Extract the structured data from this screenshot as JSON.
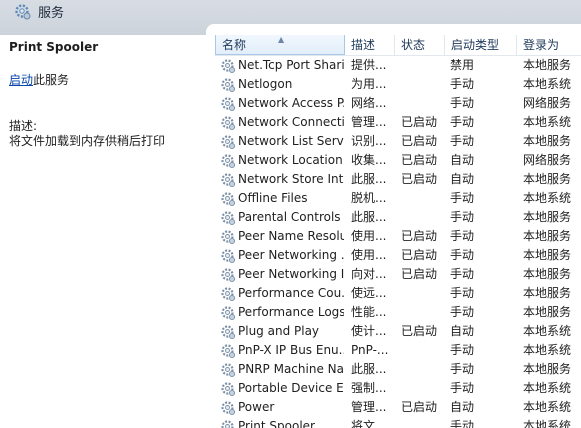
{
  "window": {
    "title": "服务"
  },
  "sidebar": {
    "service_name": "Print Spooler",
    "start_link": "启动",
    "start_suffix": "此服务",
    "desc_label": "描述:",
    "desc_text": "将文件加载到内存供稍后打印"
  },
  "table": {
    "headers": {
      "name": "名称",
      "desc": "描述",
      "status": "状态",
      "startup": "启动类型",
      "logon": "登录为"
    },
    "sort_indicator": "▲",
    "rows": [
      {
        "name": "Net.Tcp Port Shari...",
        "desc": "提供...",
        "status": "",
        "startup": "禁用",
        "logon": "本地服务"
      },
      {
        "name": "Netlogon",
        "desc": "为用...",
        "status": "",
        "startup": "手动",
        "logon": "本地系统"
      },
      {
        "name": "Network Access P...",
        "desc": "网络...",
        "status": "",
        "startup": "手动",
        "logon": "网络服务"
      },
      {
        "name": "Network Connecti...",
        "desc": "管理...",
        "status": "已启动",
        "startup": "手动",
        "logon": "本地系统"
      },
      {
        "name": "Network List Service",
        "desc": "识别...",
        "status": "已启动",
        "startup": "手动",
        "logon": "本地服务"
      },
      {
        "name": "Network Location ...",
        "desc": "收集...",
        "status": "已启动",
        "startup": "自动",
        "logon": "网络服务"
      },
      {
        "name": "Network Store Int...",
        "desc": "此服...",
        "status": "已启动",
        "startup": "自动",
        "logon": "本地服务"
      },
      {
        "name": "Offline Files",
        "desc": "脱机...",
        "status": "",
        "startup": "手动",
        "logon": "本地系统"
      },
      {
        "name": "Parental Controls",
        "desc": "此服...",
        "status": "",
        "startup": "手动",
        "logon": "本地服务"
      },
      {
        "name": "Peer Name Resolu...",
        "desc": "使用...",
        "status": "已启动",
        "startup": "手动",
        "logon": "本地服务"
      },
      {
        "name": "Peer Networking ...",
        "desc": "使用...",
        "status": "已启动",
        "startup": "手动",
        "logon": "本地服务"
      },
      {
        "name": "Peer Networking I...",
        "desc": "向对...",
        "status": "已启动",
        "startup": "手动",
        "logon": "本地服务"
      },
      {
        "name": "Performance Cou...",
        "desc": "使远...",
        "status": "",
        "startup": "手动",
        "logon": "本地服务"
      },
      {
        "name": "Performance Logs...",
        "desc": "性能...",
        "status": "",
        "startup": "手动",
        "logon": "本地服务"
      },
      {
        "name": "Plug and Play",
        "desc": "使计...",
        "status": "已启动",
        "startup": "自动",
        "logon": "本地系统"
      },
      {
        "name": "PnP-X IP Bus Enu...",
        "desc": "PnP-...",
        "status": "",
        "startup": "手动",
        "logon": "本地系统"
      },
      {
        "name": "PNRP Machine Na...",
        "desc": "此服...",
        "status": "",
        "startup": "手动",
        "logon": "本地服务"
      },
      {
        "name": "Portable Device E...",
        "desc": "强制...",
        "status": "",
        "startup": "手动",
        "logon": "本地系统"
      },
      {
        "name": "Power",
        "desc": "管理...",
        "status": "已启动",
        "startup": "自动",
        "logon": "本地系统"
      },
      {
        "name": "Print Spooler",
        "desc": "将文...",
        "status": "",
        "startup": "手动",
        "logon": "本地系统"
      }
    ]
  },
  "icons": {
    "app": "services-gear-icon",
    "row": "gear-icon"
  },
  "colors": {
    "link": "#0645ad",
    "header_text": "#1e395b",
    "topbar": "#cdd3db"
  }
}
